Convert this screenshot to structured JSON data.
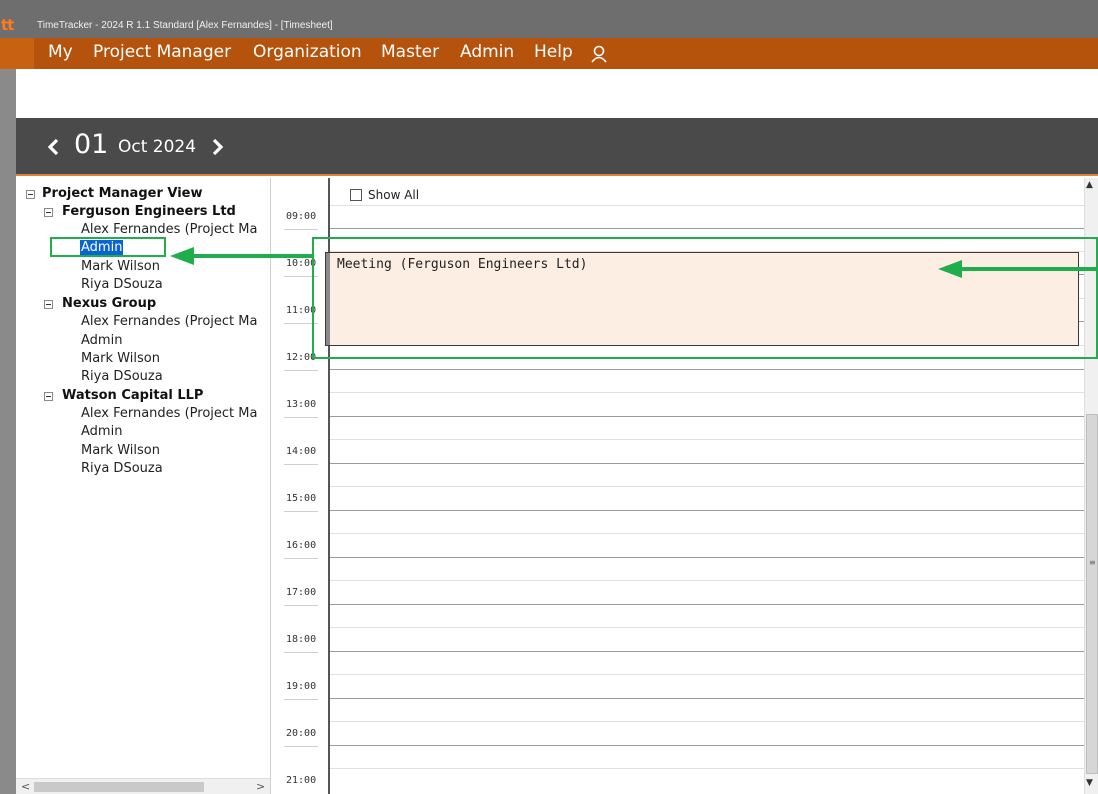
{
  "window": {
    "logo": "tt",
    "title": "TimeTracker - 2024 R 1.1 Standard [Alex Fernandes] - [Timesheet]"
  },
  "menu": {
    "items": [
      "My",
      "Project Manager",
      "Organization",
      "Master",
      "Admin",
      "Help"
    ],
    "user_icon": "user-icon"
  },
  "date_nav": {
    "day": "01",
    "month_year": "Oct 2024",
    "prev_icon": "chevron-left-icon",
    "next_icon": "chevron-right-icon"
  },
  "tree": {
    "root": "Project Manager View",
    "groups": [
      {
        "name": "Ferguson Engineers Ltd",
        "members": [
          "Alex Fernandes (Project Ma",
          "Admin",
          "Mark Wilson",
          "Riya DSouza"
        ]
      },
      {
        "name": "Nexus Group",
        "members": [
          "Alex Fernandes (Project Ma",
          "Admin",
          "Mark Wilson",
          "Riya DSouza"
        ]
      },
      {
        "name": "Watson Capital LLP",
        "members": [
          "Alex Fernandes (Project Ma",
          "Admin",
          "Mark Wilson",
          "Riya DSouza"
        ]
      }
    ],
    "selected_member": "Admin"
  },
  "schedule": {
    "show_all_label": "Show All",
    "show_all_checked": false,
    "hours": [
      "09:00",
      "10:00",
      "11:00",
      "12:00",
      "13:00",
      "14:00",
      "15:00",
      "16:00",
      "17:00",
      "18:00",
      "19:00",
      "20:00",
      "21:00"
    ],
    "event": {
      "label": "Meeting (Ferguson Engineers Ltd)",
      "start": "10:00",
      "end": "12:00"
    }
  },
  "colors": {
    "menu_bar": "#b5520c",
    "date_bar": "#4a4a4a",
    "event_fill": "#fdeee3",
    "selection": "#0a64d6",
    "annotation": "#1fae4b"
  }
}
